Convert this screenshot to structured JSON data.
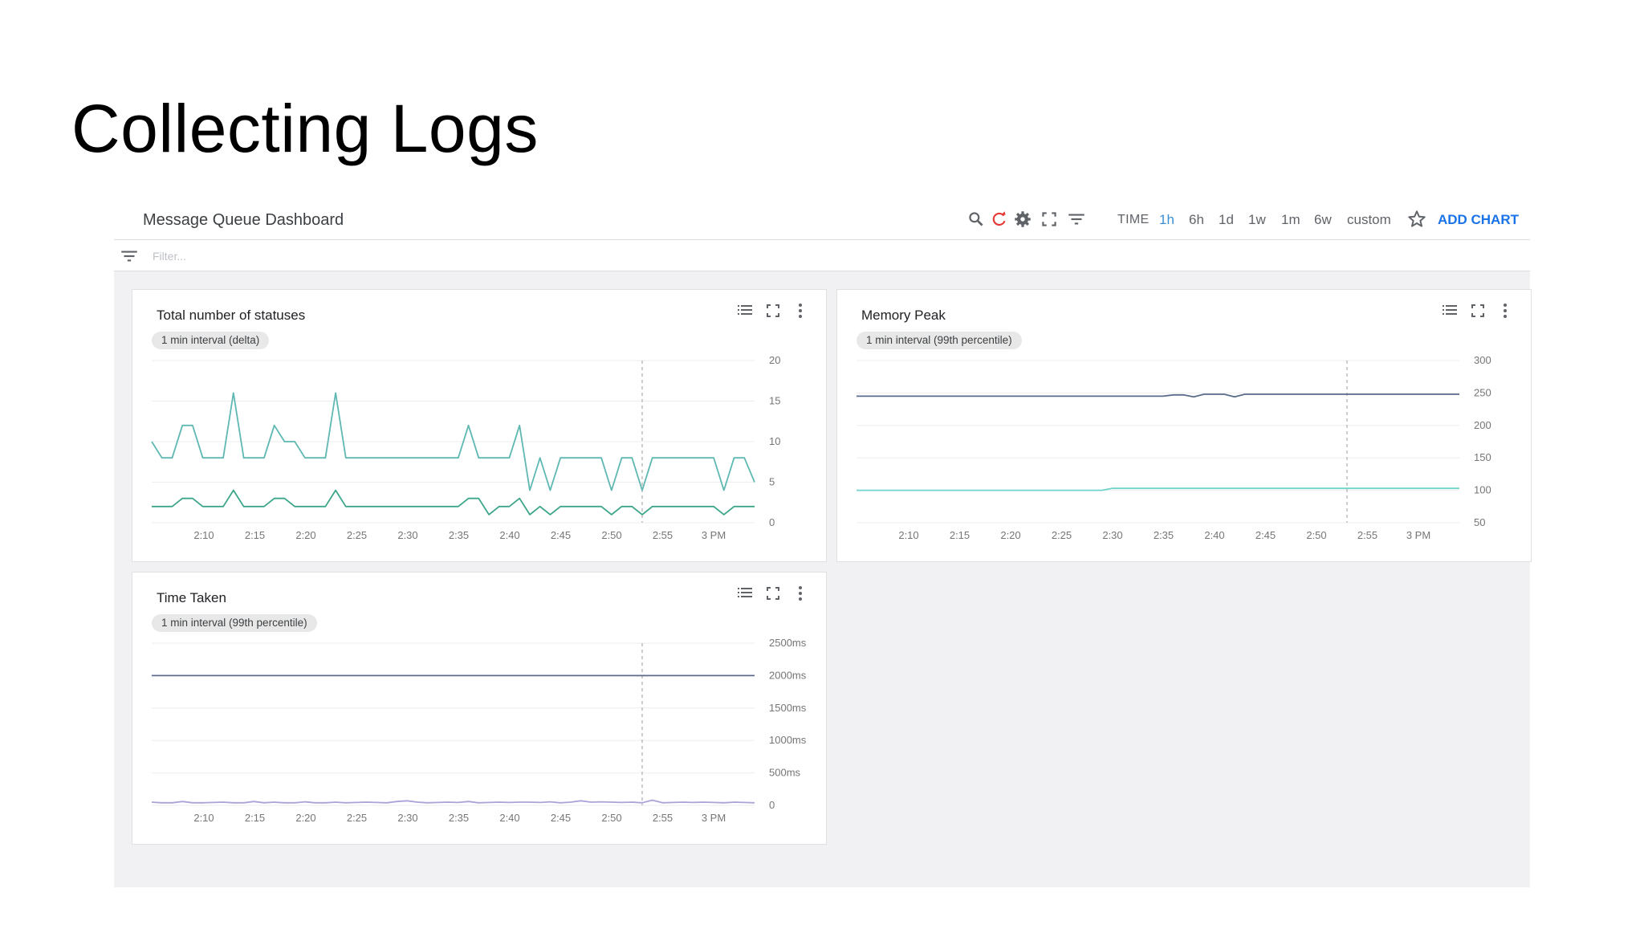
{
  "slide": {
    "title": "Collecting Logs"
  },
  "dashboard": {
    "title": "Message Queue Dashboard",
    "time_label": "TIME",
    "ranges": [
      "1h",
      "6h",
      "1d",
      "1w",
      "1m",
      "6w",
      "custom"
    ],
    "active_range": "1h",
    "add_chart": "ADD CHART",
    "filter_placeholder": "Filter...",
    "toolbar_icons": [
      "search-icon",
      "refresh-icon",
      "gear-icon",
      "fullscreen-icon",
      "filter-icon",
      "star-icon"
    ],
    "accent_color": "#1a73e8",
    "refresh_color": "#e53935"
  },
  "cards": [
    {
      "title": "Total number of statuses",
      "pill": "1 min interval (delta)"
    },
    {
      "title": "Memory Peak",
      "pill": "1 min interval (99th percentile)"
    },
    {
      "title": "Time Taken",
      "pill": "1 min interval (99th percentile)"
    }
  ],
  "chart_data": [
    {
      "type": "line",
      "x_ticks": [
        "2:10",
        "2:15",
        "2:20",
        "2:25",
        "2:30",
        "2:35",
        "2:40",
        "2:45",
        "2:50",
        "2:55",
        "3 PM"
      ],
      "y_ticks": [
        "0",
        "5",
        "10",
        "15",
        "20"
      ],
      "ylim": [
        0,
        20
      ],
      "xlim": [
        0,
        59
      ],
      "cursor_x": 48,
      "series": [
        {
          "color": "#5fb8b2",
          "values": [
            10,
            8,
            8,
            12,
            12,
            8,
            8,
            8,
            16,
            8,
            8,
            8,
            12,
            10,
            10,
            8,
            8,
            8,
            16,
            8,
            8,
            8,
            8,
            8,
            8,
            8,
            8,
            8,
            8,
            8,
            8,
            12,
            8,
            8,
            8,
            8,
            12,
            4,
            8,
            4,
            8,
            8,
            8,
            8,
            8,
            4,
            8,
            8,
            4,
            8,
            8,
            8,
            8,
            8,
            8,
            8,
            4,
            8,
            8,
            5
          ]
        },
        {
          "color": "#3da58a",
          "values": [
            2,
            2,
            2,
            3,
            3,
            2,
            2,
            2,
            4,
            2,
            2,
            2,
            3,
            3,
            2,
            2,
            2,
            2,
            4,
            2,
            2,
            2,
            2,
            2,
            2,
            2,
            2,
            2,
            2,
            2,
            2,
            3,
            3,
            1,
            2,
            2,
            3,
            1,
            2,
            1,
            2,
            2,
            2,
            2,
            2,
            1,
            2,
            2,
            1,
            2,
            2,
            2,
            2,
            2,
            2,
            2,
            1,
            2,
            2,
            2
          ]
        }
      ]
    },
    {
      "type": "line",
      "x_ticks": [
        "2:10",
        "2:15",
        "2:20",
        "2:25",
        "2:30",
        "2:35",
        "2:40",
        "2:45",
        "2:50",
        "2:55",
        "3 PM"
      ],
      "y_ticks": [
        "50",
        "100",
        "150",
        "200",
        "250",
        "300"
      ],
      "ylim": [
        50,
        300
      ],
      "xlim": [
        0,
        59
      ],
      "cursor_x": 48,
      "series": [
        {
          "color": "#5b6b8c",
          "values": [
            245,
            245,
            245,
            245,
            245,
            245,
            245,
            245,
            245,
            245,
            245,
            245,
            245,
            245,
            245,
            245,
            245,
            245,
            245,
            245,
            245,
            245,
            245,
            245,
            245,
            245,
            245,
            245,
            245,
            245,
            245,
            247,
            247,
            244,
            248,
            248,
            248,
            244,
            248,
            248,
            248,
            248,
            248,
            248,
            248,
            248,
            248,
            248,
            248,
            248,
            248,
            248,
            248,
            248,
            248,
            248,
            248,
            248,
            248,
            248
          ]
        },
        {
          "color": "#6fd3c8",
          "values": [
            100,
            100,
            100,
            100,
            100,
            100,
            100,
            100,
            100,
            100,
            100,
            100,
            100,
            100,
            100,
            100,
            100,
            100,
            100,
            100,
            100,
            100,
            100,
            100,
            100,
            103,
            103,
            103,
            103,
            103,
            103,
            103,
            103,
            103,
            103,
            103,
            103,
            103,
            103,
            103,
            103,
            103,
            103,
            103,
            103,
            103,
            103,
            103,
            103,
            103,
            103,
            103,
            103,
            103,
            103,
            103,
            103,
            103,
            103,
            103
          ]
        }
      ]
    },
    {
      "type": "line",
      "x_ticks": [
        "2:10",
        "2:15",
        "2:20",
        "2:25",
        "2:30",
        "2:35",
        "2:40",
        "2:45",
        "2:50",
        "2:55",
        "3 PM"
      ],
      "y_ticks": [
        "0",
        "500ms",
        "1000ms",
        "1500ms",
        "2000ms",
        "2500ms"
      ],
      "ylim": [
        0,
        2500
      ],
      "xlim": [
        0,
        59
      ],
      "cursor_x": 48,
      "series": [
        {
          "color": "#5b6b8c",
          "values": [
            2000,
            2000,
            2000,
            2000,
            2000,
            2000,
            2000,
            2000,
            2000,
            2000,
            2000,
            2000,
            2000,
            2000,
            2000,
            2000,
            2000,
            2000,
            2000,
            2000,
            2000,
            2000,
            2000,
            2000,
            2000,
            2000,
            2000,
            2000,
            2000,
            2000,
            2000,
            2000,
            2000,
            2000,
            2000,
            2000,
            2000,
            2000,
            2000,
            2000,
            2000,
            2000,
            2000,
            2000,
            2000,
            2000,
            2000,
            2000,
            2000,
            2000,
            2000,
            2000,
            2000,
            2000,
            2000,
            2000,
            2000,
            2000,
            2000,
            2000
          ]
        },
        {
          "color": "#a9a4d8",
          "values": [
            50,
            40,
            40,
            60,
            40,
            40,
            45,
            50,
            40,
            40,
            60,
            40,
            50,
            40,
            40,
            55,
            40,
            40,
            50,
            40,
            45,
            50,
            45,
            40,
            60,
            70,
            50,
            40,
            45,
            50,
            45,
            60,
            40,
            45,
            50,
            45,
            50,
            50,
            45,
            55,
            40,
            50,
            70,
            50,
            55,
            50,
            45,
            50,
            40,
            80,
            40,
            45,
            50,
            45,
            50,
            45,
            40,
            50,
            45,
            40
          ]
        }
      ]
    }
  ]
}
